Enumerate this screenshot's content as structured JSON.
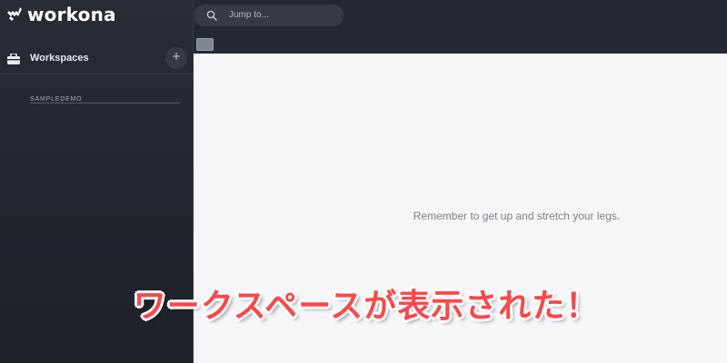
{
  "app": {
    "logo_text": "workona"
  },
  "sidebar": {
    "section_label": "Workspaces",
    "add_label": "+",
    "items": [
      {
        "label": "SAMPLEDEMO"
      }
    ]
  },
  "search": {
    "placeholder": "Jump to..."
  },
  "main": {
    "reminder": "Remember to get up and stretch your legs."
  },
  "overlay": {
    "caption": "ワークスペースが表示された！"
  },
  "colors": {
    "sidebar_bg": "#232833",
    "main_bg": "#f5f6f8",
    "caption_red": "#ff4548",
    "logo_blue": "#5fa8e8"
  },
  "icons": {
    "logo": "workona-logo-icon",
    "workspace": "briefcase-icon",
    "search": "search-icon"
  }
}
